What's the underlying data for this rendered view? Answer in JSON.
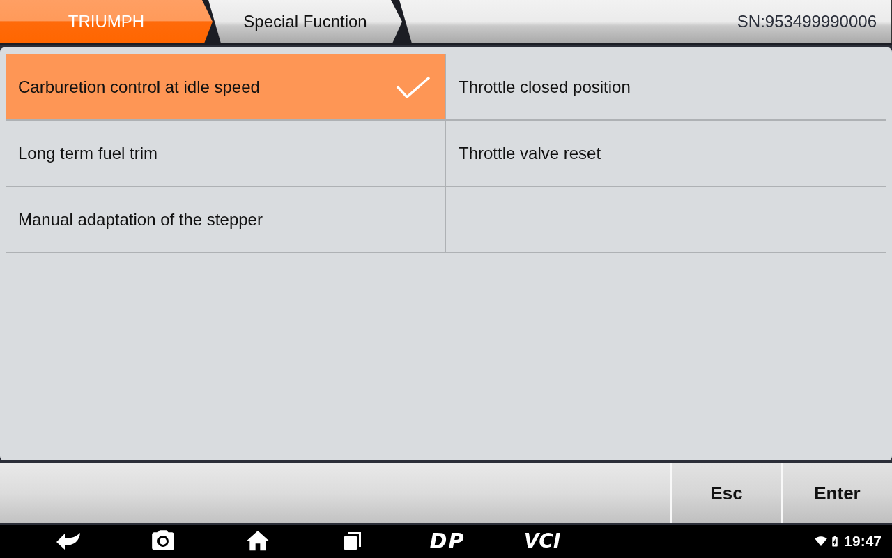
{
  "header": {
    "breadcrumbs": [
      {
        "label": "TRIUMPH",
        "selected": true
      },
      {
        "label": "Special Fucntion",
        "selected": false
      }
    ],
    "serial": "SN:953499990006"
  },
  "functions": [
    {
      "label": "Carburetion control at idle speed",
      "selected": true
    },
    {
      "label": "Throttle closed position",
      "selected": false
    },
    {
      "label": "Long term fuel trim",
      "selected": false
    },
    {
      "label": "Throttle valve reset",
      "selected": false
    },
    {
      "label": "Manual adaptation of the stepper",
      "selected": false
    }
  ],
  "action_buttons": [
    "Esc",
    "Enter"
  ],
  "nav_bar": {
    "logos": [
      "DP",
      "VCI"
    ],
    "time": "19:47"
  }
}
